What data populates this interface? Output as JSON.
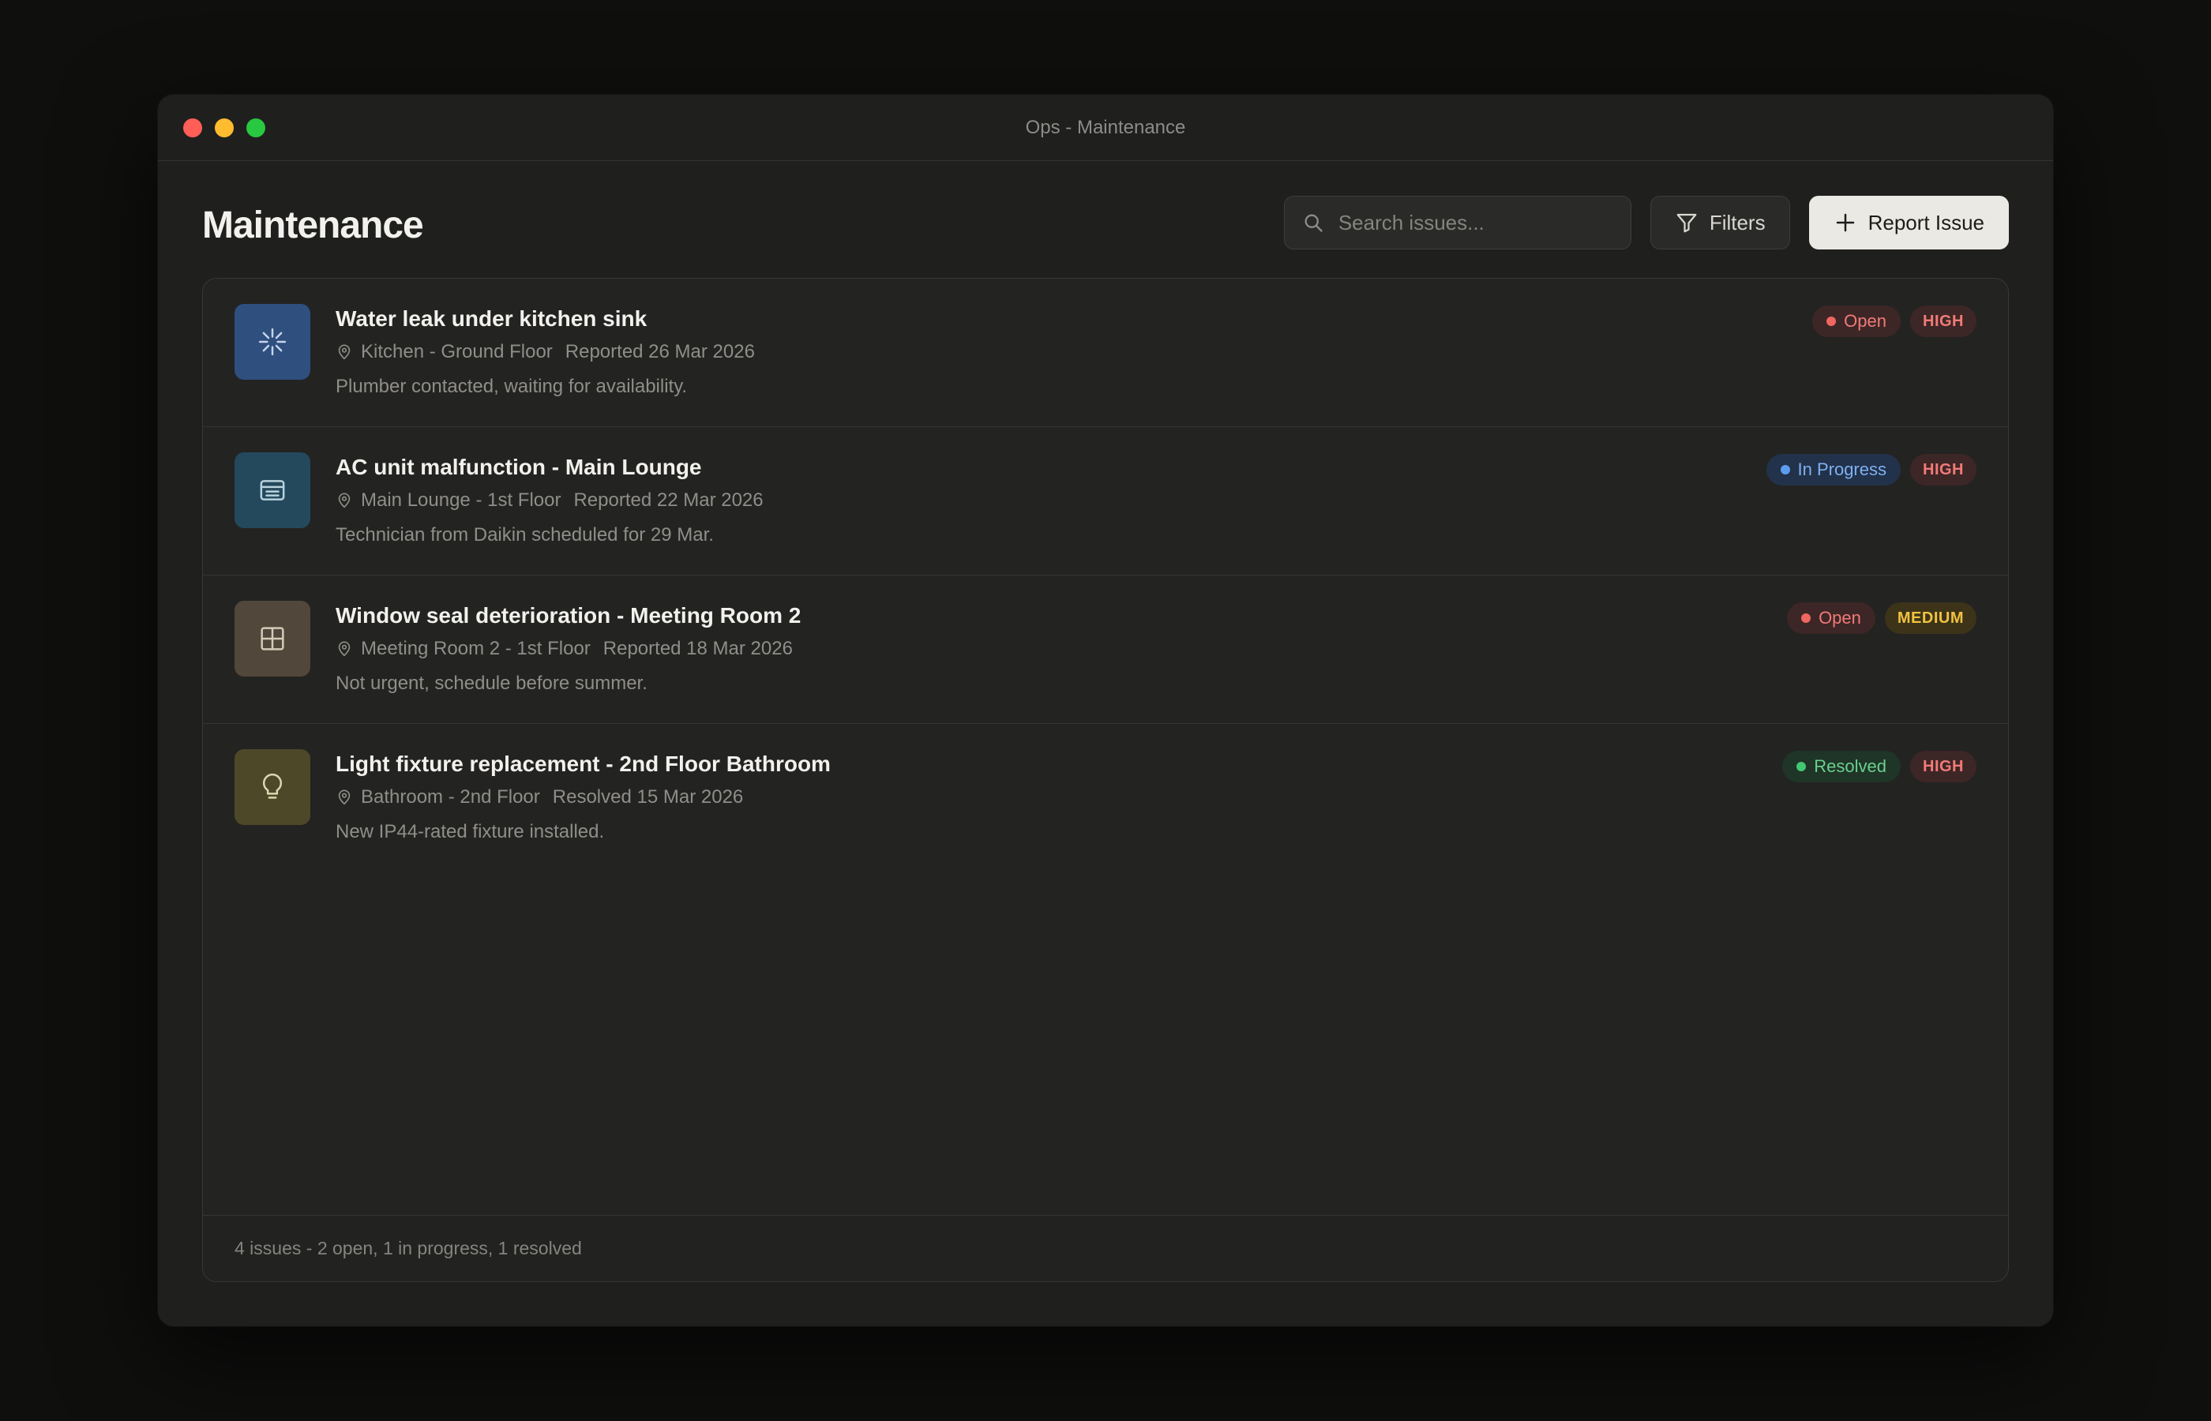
{
  "window": {
    "title": "Ops - Maintenance"
  },
  "header": {
    "title": "Maintenance",
    "search_placeholder": "Search issues...",
    "filters_label": "Filters",
    "report_label": "Report Issue"
  },
  "issues": [
    {
      "title": "Water leak under kitchen sink",
      "location": "Kitchen - Ground Floor",
      "date": "Reported 26 Mar 2026",
      "note": "Plumber contacted, waiting for availability.",
      "status": "Open",
      "priority": "HIGH",
      "icon": "sparkle-icon",
      "icon_color": "#2f4f7e"
    },
    {
      "title": "AC unit malfunction - Main Lounge",
      "location": "Main Lounge - 1st Floor",
      "date": "Reported 22 Mar 2026",
      "note": "Technician from Daikin scheduled for 29 Mar.",
      "status": "In Progress",
      "priority": "HIGH",
      "icon": "ac-unit-icon",
      "icon_color": "#24495c"
    },
    {
      "title": "Window seal deterioration - Meeting Room 2",
      "location": "Meeting Room 2 - 1st Floor",
      "date": "Reported 18 Mar 2026",
      "note": "Not urgent, schedule before summer.",
      "status": "Open",
      "priority": "MEDIUM",
      "icon": "window-icon",
      "icon_color": "#52473b"
    },
    {
      "title": "Light fixture replacement - 2nd Floor Bathroom",
      "location": "Bathroom - 2nd Floor",
      "date": "Resolved 15 Mar 2026",
      "note": "New IP44-rated fixture installed.",
      "status": "Resolved",
      "priority": "HIGH",
      "icon": "lightbulb-icon",
      "icon_color": "#4d4828"
    }
  ],
  "footer": {
    "summary": "4 issues - 2 open, 1 in progress, 1 resolved"
  }
}
